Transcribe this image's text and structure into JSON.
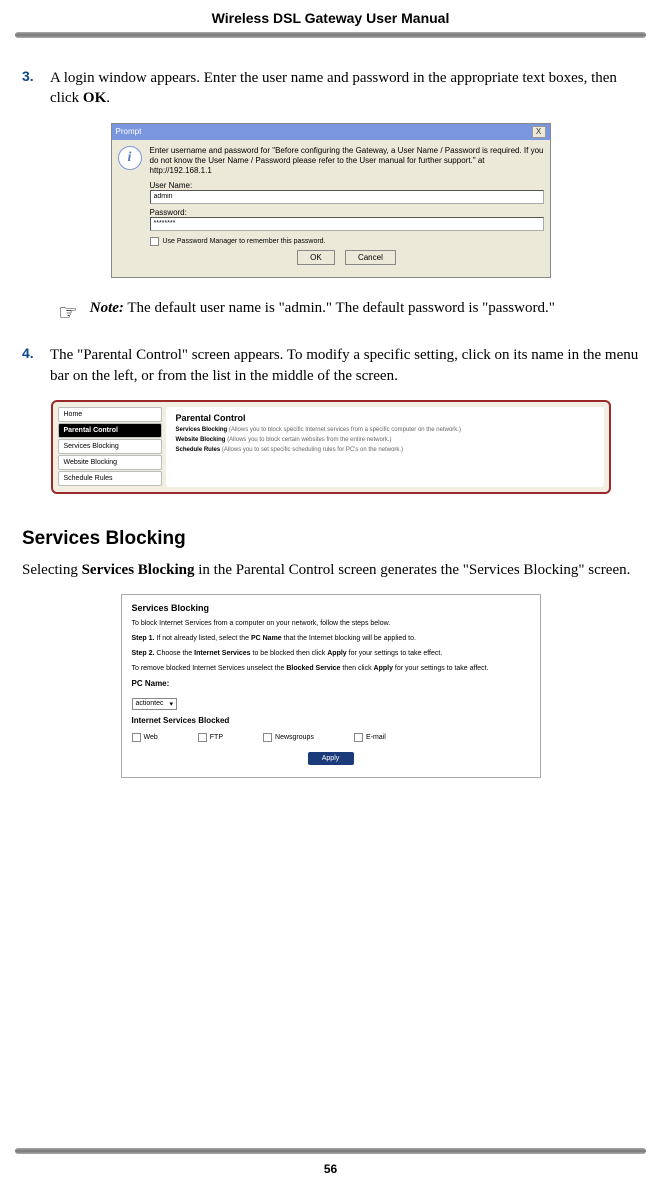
{
  "header": {
    "title": "Wireless DSL Gateway User Manual"
  },
  "step3": {
    "num": "3.",
    "text_before": " A login window appears. Enter the user name and password in the appropriate text boxes, then click ",
    "bold": "OK",
    "text_after": "."
  },
  "prompt": {
    "title": "Prompt",
    "close": "X",
    "info": "i",
    "msg": "Enter username and password for \"Before configuring the Gateway, a User Name / Password is required. If you do not know the User Name / Password please refer to the User manual for further support.\" at http://192.168.1.1",
    "user_label": "User Name:",
    "user_value": "admin",
    "pass_label": "Password:",
    "pass_value": "********",
    "remember": "Use Password Manager to remember this password.",
    "ok": "OK",
    "cancel": "Cancel"
  },
  "note": {
    "prefix": "Note:",
    "text": " The default user name is \"admin.\" The default password is \"password.\""
  },
  "step4": {
    "num": "4.",
    "text": "The \"Parental Control\" screen appears. To modify a specific setting, click on its name in the menu bar on the left, or from the list in the middle of the screen."
  },
  "parental": {
    "side": [
      "Home",
      "Parental Control",
      "Services Blocking",
      "Website Blocking",
      "Schedule Rules"
    ],
    "title": "Parental Control",
    "rows": [
      {
        "b": "Services Blocking",
        "t": " (Allows you to block specific Internet services from a specific computer on the network.)"
      },
      {
        "b": "Website Blocking",
        "t": " (Allows you to block certain websites from the entire network.)"
      },
      {
        "b": "Schedule Rules",
        "t": " (Allows you to set specific scheduling rules for PC's on the network.)"
      }
    ]
  },
  "section": {
    "heading": "Services Blocking"
  },
  "para1": {
    "a": "Selecting ",
    "b": "Services Blocking",
    "c": " in the Parental Control screen generates the \"Services Blocking\" screen."
  },
  "sb": {
    "title": "Services Blocking",
    "line1": "To block Internet Services from a computer on your network, follow the steps below.",
    "line2a": "Step 1.",
    "line2b": " If not already listed, select the ",
    "line2c": "PC Name",
    "line2d": " that the Internet blocking will be applied to.",
    "line3a": "Step 2.",
    "line3b": " Choose the ",
    "line3c": "Internet Services",
    "line3d": " to be blocked then click ",
    "line3e": "Apply",
    "line3f": " for your settings to take effect.",
    "line4a": "To remove blocked Internet Services unselect the ",
    "line4b": "Blocked Service",
    "line4c": " then click ",
    "line4d": "Apply",
    "line4e": " for your settings to take affect.",
    "pcname_label": "PC Name:",
    "pcname_value": "actiontec",
    "svc_label": "Internet Services Blocked",
    "checks": [
      "Web",
      "FTP",
      "Newsgroups",
      "E-mail"
    ],
    "apply": "Apply"
  },
  "pagenum": "56"
}
